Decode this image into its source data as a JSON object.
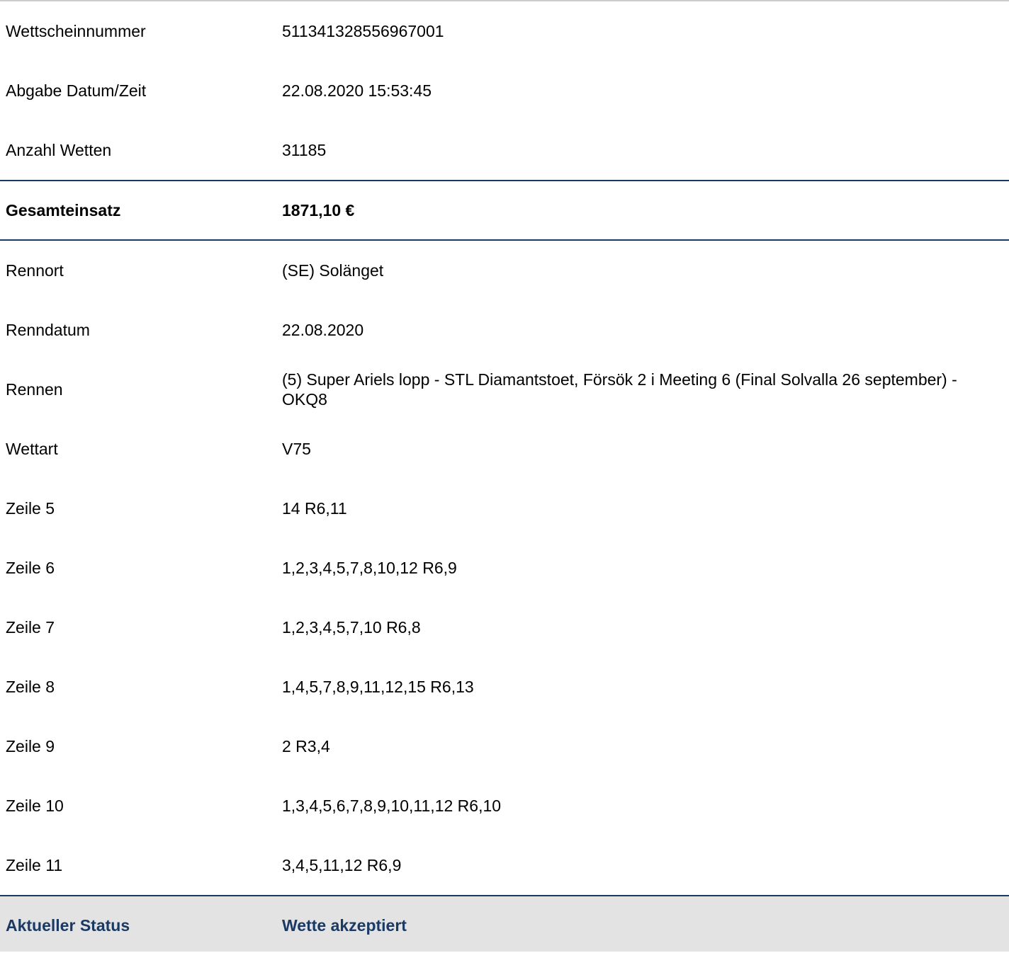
{
  "header_rows": [
    {
      "label": "Wettscheinnummer",
      "value": "511341328556967001"
    },
    {
      "label": "Abgabe Datum/Zeit",
      "value": "22.08.2020 15:53:45"
    },
    {
      "label": "Anzahl Wetten",
      "value": "31185"
    }
  ],
  "total": {
    "label": "Gesamteinsatz",
    "value": "1871,10 €"
  },
  "detail_rows": [
    {
      "label": "Rennort",
      "value": "(SE) Solänget"
    },
    {
      "label": "Renndatum",
      "value": "22.08.2020"
    },
    {
      "label": "Rennen",
      "value": "(5) Super Ariels lopp - STL Diamantstoet, Försök 2 i Meeting 6 (Final Solvalla 26 september) - OKQ8"
    },
    {
      "label": "Wettart",
      "value": "V75"
    },
    {
      "label": "Zeile 5",
      "value": "14 R6,11"
    },
    {
      "label": "Zeile 6",
      "value": "1,2,3,4,5,7,8,10,12 R6,9"
    },
    {
      "label": "Zeile 7",
      "value": "1,2,3,4,5,7,10 R6,8"
    },
    {
      "label": "Zeile 8",
      "value": "1,4,5,7,8,9,11,12,15 R6,13"
    },
    {
      "label": "Zeile 9",
      "value": "2 R3,4"
    },
    {
      "label": "Zeile 10",
      "value": "1,3,4,5,6,7,8,9,10,11,12 R6,10"
    },
    {
      "label": "Zeile 11",
      "value": "3,4,5,11,12 R6,9"
    }
  ],
  "status": {
    "label": "Aktueller Status",
    "value": "Wette akzeptiert"
  },
  "colors": {
    "accent": "#1a3a63",
    "status_background": "#e3e3e3",
    "top_border": "#cccccc"
  }
}
